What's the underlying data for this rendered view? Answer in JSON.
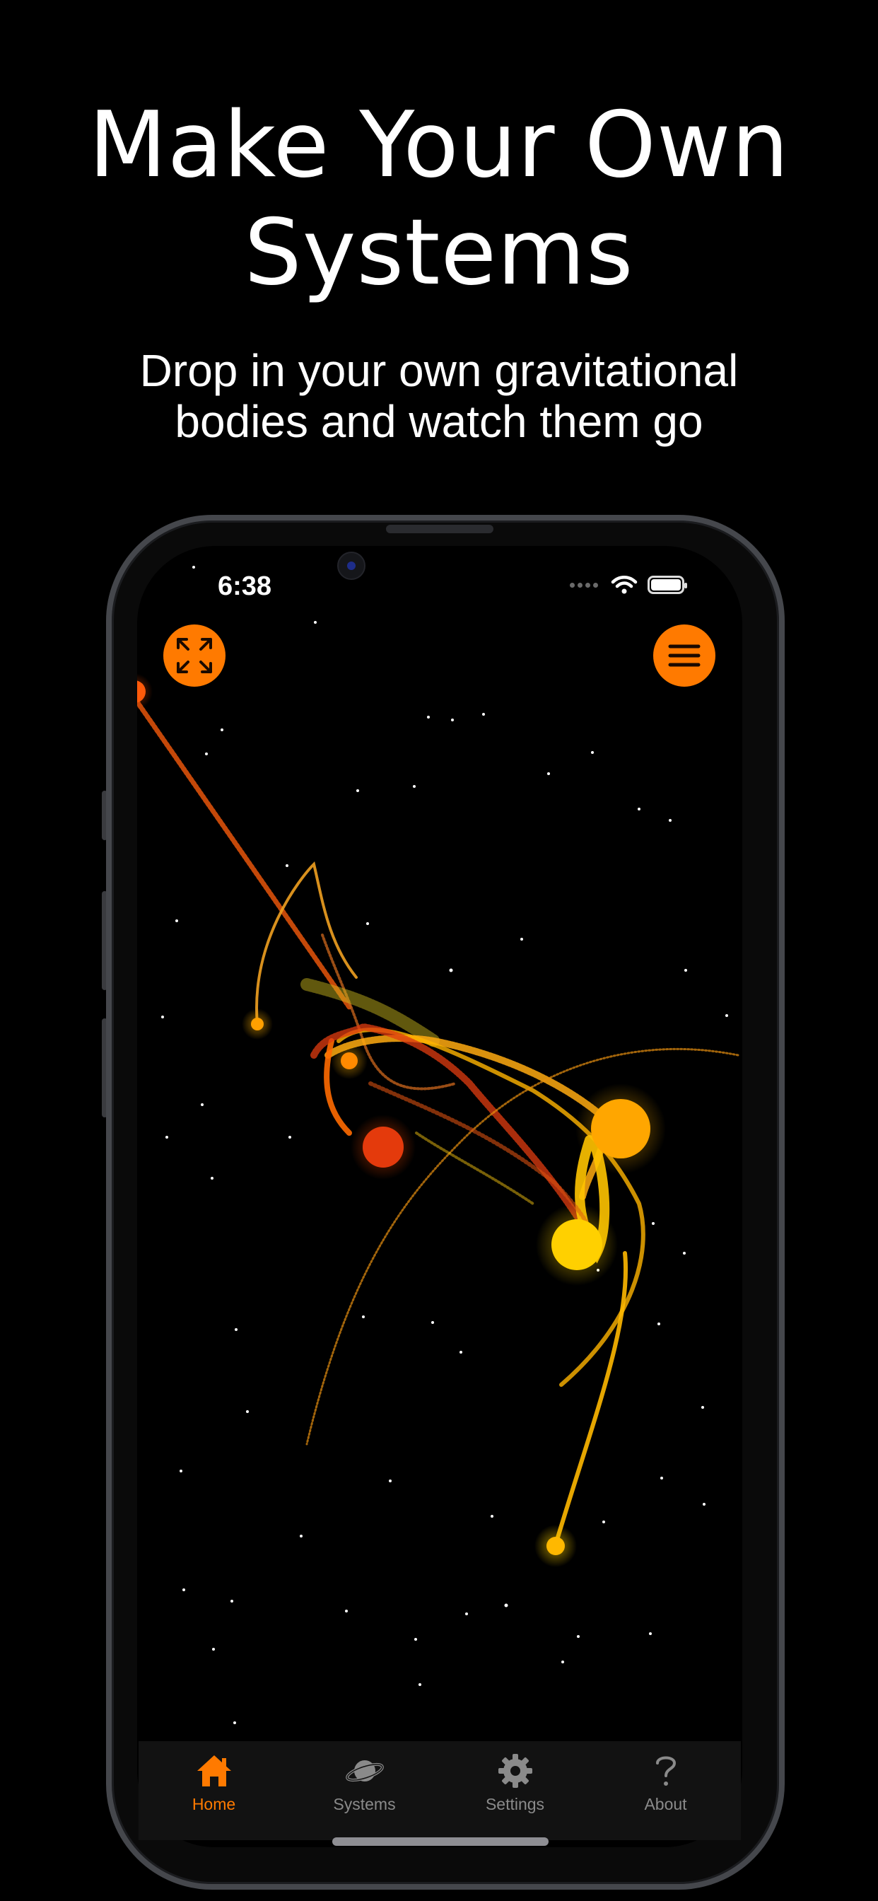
{
  "headline": {
    "line1": "Make Your Own",
    "line2": "Systems"
  },
  "subhead": {
    "line1": "Drop in your own gravitational",
    "line2": "bodies and watch them go"
  },
  "status_bar": {
    "time": "6:38"
  },
  "controls": {
    "expand_icon": "expand-arrows-icon",
    "menu_icon": "hamburger-menu-icon"
  },
  "tabs": [
    {
      "label": "Home",
      "icon": "house-icon",
      "active": true
    },
    {
      "label": "Systems",
      "icon": "planet-icon",
      "active": false
    },
    {
      "label": "Settings",
      "icon": "gear-icon",
      "active": false
    },
    {
      "label": "About",
      "icon": "question-mark-icon",
      "active": false
    }
  ],
  "colors": {
    "background": "#000000",
    "accent": "#ff7a00",
    "tab_inactive": "#8a8a8a",
    "tabbar": "#121212"
  }
}
